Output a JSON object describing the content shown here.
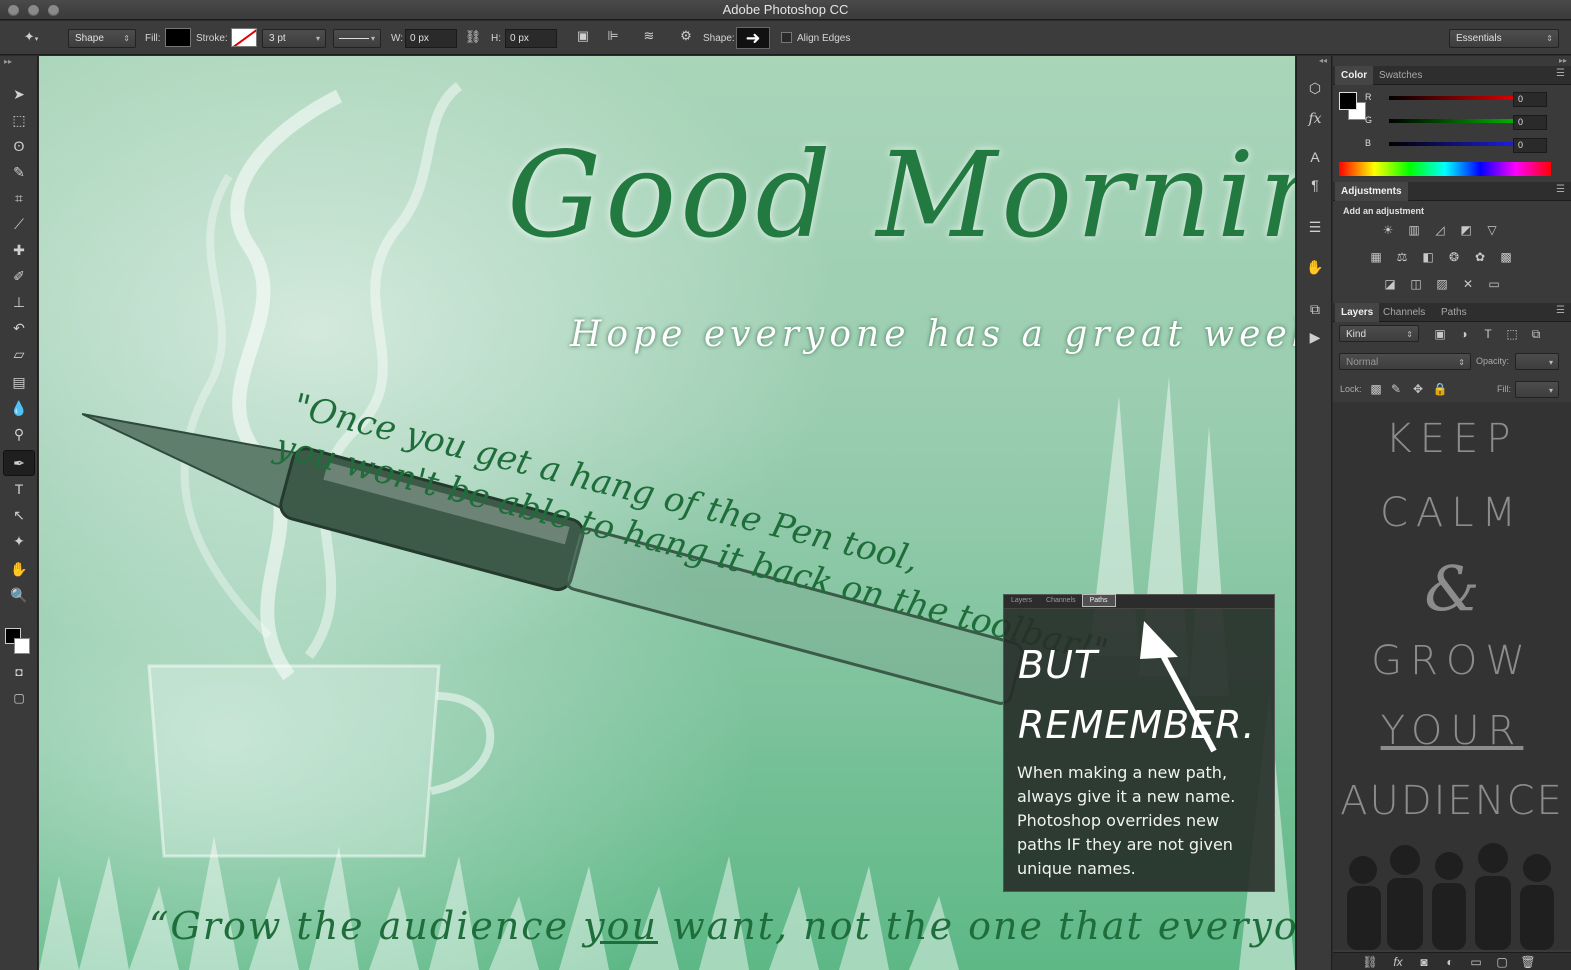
{
  "app": {
    "title": "Adobe Photoshop CC"
  },
  "options_bar": {
    "tool_mode": "Shape",
    "fill_label": "Fill:",
    "stroke_label": "Stroke:",
    "stroke_width": "3 pt",
    "width_label": "W:",
    "width_value": "0 px",
    "height_label": "H:",
    "height_value": "0 px",
    "shape_label": "Shape:",
    "align_edges_label": "Align Edges",
    "align_edges_checked": false,
    "workspace": "Essentials"
  },
  "toolbar": {
    "tools": [
      "move-tool",
      "marquee-tool",
      "lasso-tool",
      "quick-select-tool",
      "crop-tool",
      "eyedropper-tool",
      "healing-brush-tool",
      "brush-tool",
      "clone-stamp-tool",
      "history-brush-tool",
      "eraser-tool",
      "gradient-tool",
      "blur-tool",
      "dodge-tool",
      "pen-tool",
      "type-tool",
      "path-select-tool",
      "custom-shape-tool",
      "hand-tool",
      "zoom-tool"
    ],
    "active_tool": "pen-tool"
  },
  "canvas": {
    "headline": "Good Morning!",
    "subheadline": "Hope everyone has a great weekend!",
    "quote_line1": "\"Once you get a hang of the Pen tool,",
    "quote_line2": "you won't be able to hang it back on the toolbar!\"",
    "bottom_quote_pre": "“Grow the audience ",
    "bottom_quote_em": "you",
    "bottom_quote_post": " want, not the one that everyone wants!”",
    "tip": {
      "tab_layers": "Layers",
      "tab_channels": "Channels",
      "tab_paths": "Paths",
      "heading1": "BUT",
      "heading2": "REMEMBER.",
      "body": "When making a new path, always give it a new name. Photoshop overrides new paths IF they are not given unique names."
    }
  },
  "color_panel": {
    "tab_color": "Color",
    "tab_swatches": "Swatches",
    "r_label": "R",
    "r_value": "0",
    "g_label": "G",
    "g_value": "0",
    "b_label": "B",
    "b_value": "0"
  },
  "adjustments_panel": {
    "tab": "Adjustments",
    "heading": "Add an adjustment"
  },
  "layers_panel": {
    "tab_layers": "Layers",
    "tab_channels": "Channels",
    "tab_paths": "Paths",
    "filter": "Kind",
    "blend_mode": "Normal",
    "opacity_label": "Opacity:",
    "lock_label": "Lock:",
    "fill_label": "Fill:"
  },
  "keep_calm": {
    "line1": "KEEP",
    "line2": "CALM",
    "line3": "&",
    "line4": "GROW",
    "line5": "YOUR",
    "line6": "AUDIENCE"
  },
  "colors": {
    "headline_green": "#1f6d3a",
    "canvas_green": "#9acdb0",
    "panel_bg": "#3a3a3a"
  }
}
